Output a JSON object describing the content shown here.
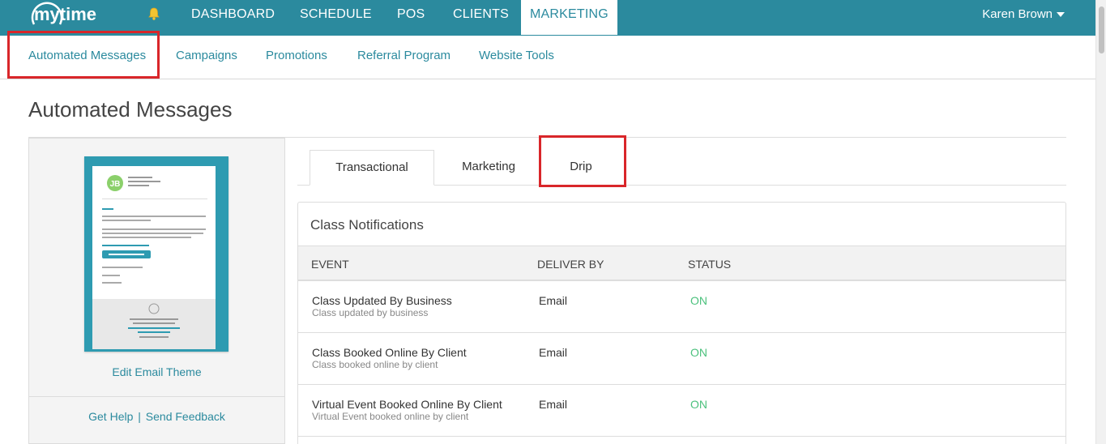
{
  "brand": {
    "logo_text": "mytime",
    "primary_color": "#2b8a9e",
    "status_on_color": "#4cc17d",
    "highlight_color": "#d9262a"
  },
  "topnav": {
    "items": [
      {
        "label": "DASHBOARD"
      },
      {
        "label": "SCHEDULE"
      },
      {
        "label": "POS"
      },
      {
        "label": "CLIENTS"
      },
      {
        "label": "MARKETING",
        "active": true
      }
    ],
    "user_name": "Karen Brown",
    "bell_icon": "bell-icon"
  },
  "subnav": {
    "items": [
      {
        "label": "Automated Messages",
        "active": true
      },
      {
        "label": "Campaigns"
      },
      {
        "label": "Promotions"
      },
      {
        "label": "Referral Program"
      },
      {
        "label": "Website Tools"
      }
    ]
  },
  "page": {
    "title": "Automated Messages"
  },
  "left_panel": {
    "edit_theme_label": "Edit Email Theme",
    "help_label": "Get Help",
    "separator": "|",
    "feedback_label": "Send Feedback"
  },
  "tabs": [
    {
      "label": "Transactional",
      "active": true
    },
    {
      "label": "Marketing"
    },
    {
      "label": "Drip"
    }
  ],
  "notifications": {
    "title": "Class Notifications",
    "columns": [
      "EVENT",
      "DELIVER BY",
      "STATUS"
    ],
    "rows": [
      {
        "name": "Class Updated By Business",
        "desc": "Class updated by business",
        "deliver": "Email",
        "status": "ON"
      },
      {
        "name": "Class Booked Online By Client",
        "desc": "Class booked online by client",
        "deliver": "Email",
        "status": "ON"
      },
      {
        "name": "Virtual Event Booked Online By Client",
        "desc": "Virtual Event booked online by client",
        "deliver": "Email",
        "status": "ON"
      }
    ]
  }
}
